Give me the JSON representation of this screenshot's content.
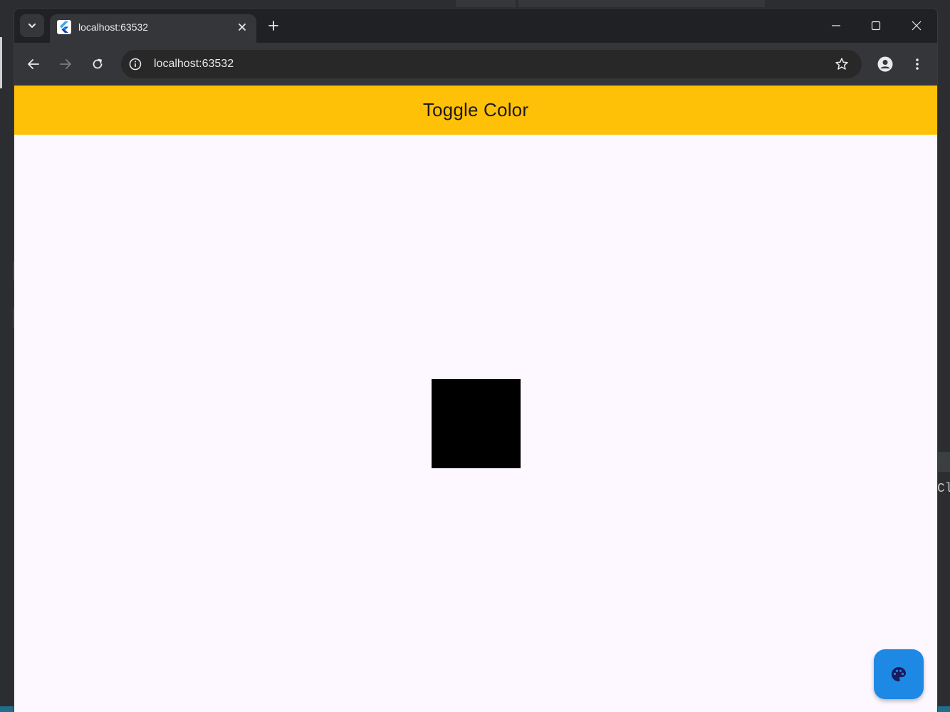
{
  "browser": {
    "tab_title": "localhost:63532",
    "url": "localhost:63532",
    "favicon": "flutter-logo-icon"
  },
  "page": {
    "appbar_title": "Toggle Color",
    "appbar_color": "#ffc107",
    "background_color": "#fdf7ff",
    "square_color": "#000000",
    "fab_color": "#1e88e5",
    "fab_icon": "palette-icon"
  },
  "background_app": {
    "right_edge_text": "Cla"
  }
}
